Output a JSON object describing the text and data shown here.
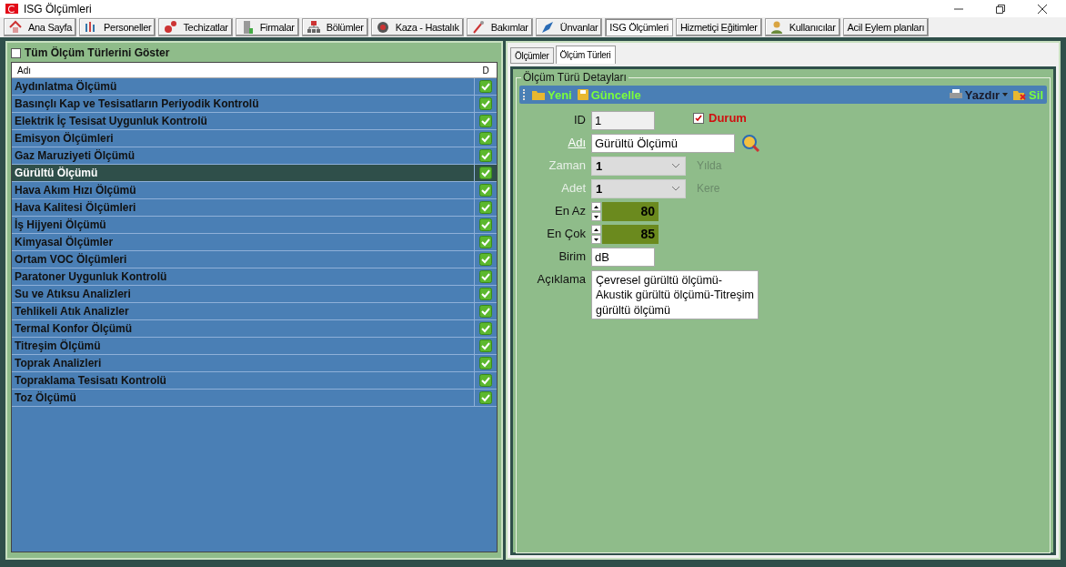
{
  "window": {
    "title": "ISG Ölçümleri"
  },
  "toolbar": [
    {
      "label": "Ana Sayfa",
      "selected": false
    },
    {
      "label": "Personeller",
      "selected": false
    },
    {
      "label": "Techizatlar",
      "selected": false
    },
    {
      "label": "Firmalar",
      "selected": false
    },
    {
      "label": "Bölümler",
      "selected": false
    },
    {
      "label": "Kaza - Hastalık",
      "selected": false
    },
    {
      "label": "Bakımlar",
      "selected": false
    },
    {
      "label": "Ünvanlar",
      "selected": false
    },
    {
      "label": "ISG Ölçümleri",
      "selected": true
    },
    {
      "label": "Hizmetiçi Eğitimler",
      "selected": false
    },
    {
      "label": "Kullanıcılar",
      "selected": false
    },
    {
      "label": "Acil Eylem planları",
      "selected": false
    }
  ],
  "list_panel": {
    "show_all": {
      "label": "Tüm Ölçüm Türlerini Göster",
      "checked": false
    },
    "columns": [
      "Adı",
      "D"
    ],
    "rows": [
      {
        "name": "Aydınlatma Ölçümü",
        "checked": true,
        "selected": false
      },
      {
        "name": "Basınçlı Kap ve Tesisatların Periyodik Kontrolü",
        "checked": true,
        "selected": false
      },
      {
        "name": "Elektrik İç Tesisat Uygunluk Kontrolü",
        "checked": true,
        "selected": false
      },
      {
        "name": "Emisyon Ölçümleri",
        "checked": true,
        "selected": false
      },
      {
        "name": "Gaz Maruziyeti Ölçümü",
        "checked": true,
        "selected": false
      },
      {
        "name": "Gürültü Ölçümü",
        "checked": true,
        "selected": true
      },
      {
        "name": "Hava Akım Hızı Ölçümü",
        "checked": true,
        "selected": false
      },
      {
        "name": "Hava Kalitesi Ölçümleri",
        "checked": true,
        "selected": false
      },
      {
        "name": "İş Hijyeni Ölçümü",
        "checked": true,
        "selected": false
      },
      {
        "name": "Kimyasal Ölçümler",
        "checked": true,
        "selected": false
      },
      {
        "name": "Ortam VOC Ölçümleri",
        "checked": true,
        "selected": false
      },
      {
        "name": "Paratoner Uygunluk Kontrolü",
        "checked": true,
        "selected": false
      },
      {
        "name": "Su ve Atıksu Analizleri",
        "checked": true,
        "selected": false
      },
      {
        "name": "Tehlikeli Atık Analizler",
        "checked": true,
        "selected": false
      },
      {
        "name": "Termal Konfor Ölçümü",
        "checked": true,
        "selected": false
      },
      {
        "name": "Titreşim Ölçümü",
        "checked": true,
        "selected": false
      },
      {
        "name": "Toprak Analizleri",
        "checked": true,
        "selected": false
      },
      {
        "name": "Topraklama Tesisatı Kontrolü",
        "checked": true,
        "selected": false
      },
      {
        "name": "Toz Ölçümü",
        "checked": true,
        "selected": false
      }
    ]
  },
  "tabs": [
    {
      "label": "Ölçümler",
      "selected": false
    },
    {
      "label": "Ölçüm Türleri",
      "selected": true
    }
  ],
  "details": {
    "title": "Ölçüm Türü Detayları",
    "actions_left": [
      "Yeni",
      "Güncelle"
    ],
    "print": "Yazdır",
    "delete": "Sil",
    "status": {
      "label": "Durum",
      "checked": true
    },
    "fields": [
      {
        "kind": "text",
        "label": "ID",
        "value": "1",
        "disabled": false
      },
      {
        "kind": "link",
        "label": "Adı",
        "value": "Gürültü Ölçümü",
        "disabled": false
      },
      {
        "kind": "select",
        "label": "Zaman",
        "value": "1",
        "suffix": "Yılda",
        "disabled": true
      },
      {
        "kind": "select",
        "label": "Adet",
        "value": "1",
        "suffix": "Kere",
        "disabled": true
      },
      {
        "kind": "spin",
        "label": "En Az",
        "value": "80",
        "disabled": false
      },
      {
        "kind": "spin",
        "label": "En Çok",
        "value": "85",
        "disabled": false
      },
      {
        "kind": "text",
        "label": "Birim",
        "value": "dB",
        "disabled": false
      },
      {
        "kind": "textarea",
        "label": "Açıklama",
        "value": "Çevresel gürültü ölçümü-Akustik gürültü ölçümü-Titreşim gürültü ölçümü",
        "disabled": false
      }
    ]
  }
}
